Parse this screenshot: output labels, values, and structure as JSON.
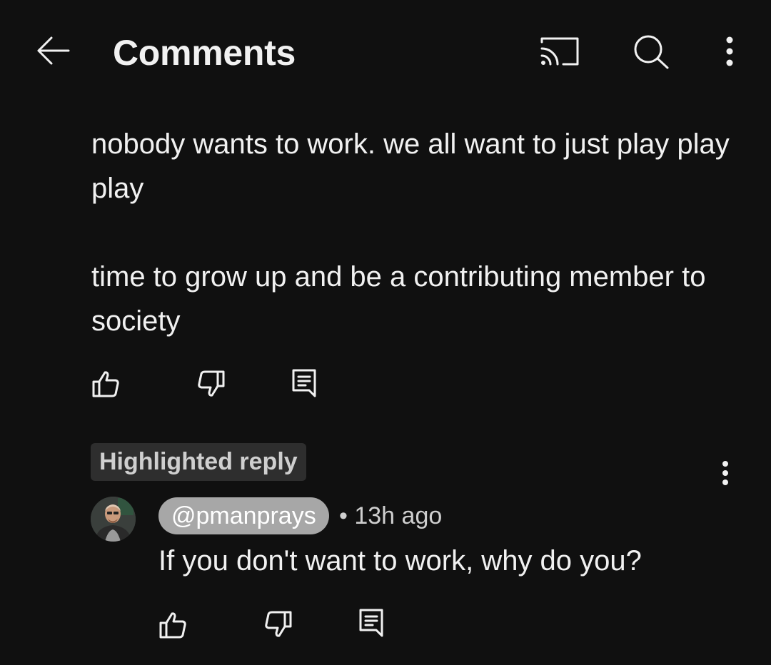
{
  "header": {
    "title": "Comments",
    "icons": [
      "back-arrow-icon",
      "cast-icon",
      "search-icon",
      "more-vert-icon"
    ]
  },
  "comment": {
    "paragraphs": [
      "nobody wants to work. we all want to just play play play",
      "time to grow up and be a contributing member to society"
    ],
    "actions": [
      "like-icon",
      "dislike-icon",
      "reply-icon"
    ]
  },
  "reply": {
    "badge": "Highlighted reply",
    "author": "@pmanprays",
    "separator": "•",
    "time": "13h ago",
    "text": "If you don't want to work, why do you?",
    "actions": [
      "like-icon",
      "dislike-icon",
      "reply-icon"
    ]
  },
  "colors": {
    "background": "#101010",
    "text": "#f1f1f1",
    "badge_bg": "#2e2e2e",
    "pill_bg": "#a7a7a7",
    "secondary_text": "#cfcfcf"
  }
}
